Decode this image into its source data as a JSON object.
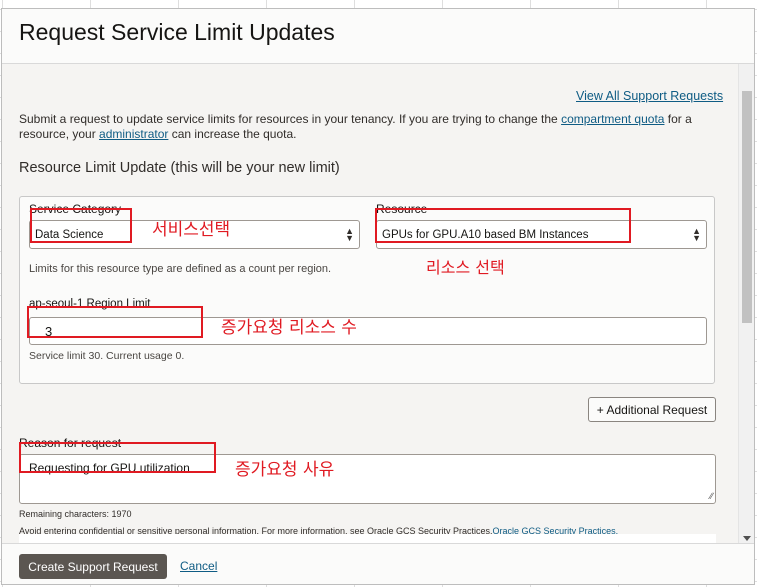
{
  "dialog": {
    "title": "Request Service Limit Updates"
  },
  "header_links": {
    "view_all": "View All Support Requests"
  },
  "intro": {
    "text_1": "Submit a request to update service limits for resources in your tenancy. If you are trying to change the ",
    "link_1": "compartment quota",
    "text_2": " for a resource, your ",
    "link_2": "administrator",
    "text_3": " can increase the quota."
  },
  "section": {
    "title": "Resource Limit Update (this will be your new limit)"
  },
  "form": {
    "service_category": {
      "label": "Service Category",
      "value": "Data Science"
    },
    "resource": {
      "label": "Resource",
      "value": "GPUs for GPU.A10 based BM Instances"
    },
    "limits_help": "Limits for this resource type are defined as a count per region.",
    "region_limit": {
      "label": "ap-seoul-1 Region Limit",
      "value": "3"
    },
    "service_limit_help": "Service limit 30. Current usage 0.",
    "additional_request": "+ Additional Request",
    "reason": {
      "label": "Reason for request",
      "value": "Requesting for GPU utilization"
    },
    "remaining": "Remaining characters: 1970",
    "disclaimer_text": "Avoid entering confidential or sensitive personal information. For more information, see Oracle GCS Security Practices.",
    "disclaimer_link": "Oracle GCS Security Practices."
  },
  "annotations": {
    "service_select": "서비스선택",
    "resource_select": "리소스 선택",
    "increase_count": "증가요청 리소스 수",
    "increase_reason": "증가요청 사유"
  },
  "footer": {
    "create": "Create Support Request",
    "cancel": "Cancel"
  },
  "colors": {
    "annotation_red": "#e01a22",
    "primary_button": "#5b5651",
    "link": "#0f5c84"
  }
}
